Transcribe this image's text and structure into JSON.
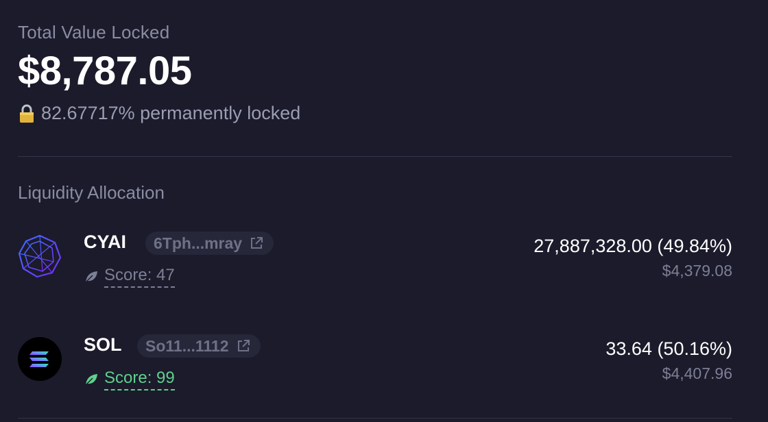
{
  "summary": {
    "title": "Total Value Locked",
    "value": "$8,787.05",
    "locked_text": "82.67717% permanently locked",
    "lock_icon": "lock-icon"
  },
  "allocation": {
    "title": "Liquidity Allocation",
    "tokens": [
      {
        "symbol": "CYAI",
        "address_short": "6Tph...mray",
        "score_label": "Score: 47",
        "amount": "27,887,328.00 (49.84%)",
        "usd": "$4,379.08",
        "icon": "cyai-logo-icon",
        "score_color": "#7d7f96"
      },
      {
        "symbol": "SOL",
        "address_short": "So11...1112",
        "score_label": "Score: 99",
        "amount": "33.64 (50.16%)",
        "usd": "$4,407.96",
        "icon": "sol-logo-icon",
        "score_color": "#5fd08e"
      }
    ]
  }
}
